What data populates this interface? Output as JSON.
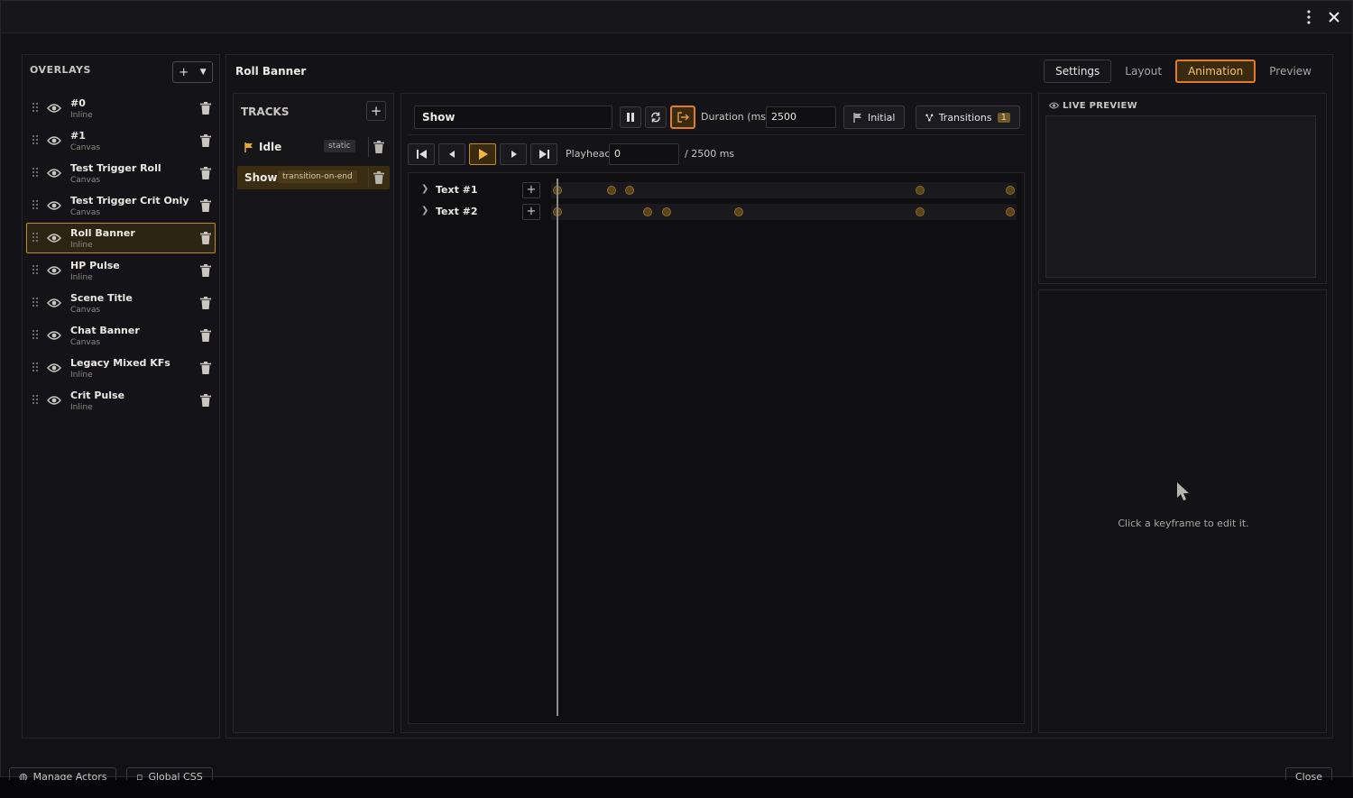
{
  "overlays": {
    "title": "OVERLAYS",
    "items": [
      {
        "name": "#0",
        "type": "Inline"
      },
      {
        "name": "#1",
        "type": "Canvas"
      },
      {
        "name": "Test Trigger Roll",
        "type": "Canvas"
      },
      {
        "name": "Test Trigger Crit Only",
        "type": "Canvas"
      },
      {
        "name": "Roll Banner",
        "type": "Inline",
        "active": true
      },
      {
        "name": "HP Pulse",
        "type": "Inline"
      },
      {
        "name": "Scene Title",
        "type": "Canvas"
      },
      {
        "name": "Chat Banner",
        "type": "Canvas"
      },
      {
        "name": "Legacy Mixed KFs",
        "type": "Inline"
      },
      {
        "name": "Crit Pulse",
        "type": "Inline"
      }
    ]
  },
  "main": {
    "title": "Roll Banner",
    "tabs": [
      {
        "label": "Settings"
      },
      {
        "label": "Layout"
      },
      {
        "label": "Animation",
        "active": true
      },
      {
        "label": "Preview"
      }
    ]
  },
  "tracks": {
    "title": "TRACKS",
    "items": [
      {
        "name": "Idle",
        "badge": "static",
        "icon": "flag-icon"
      },
      {
        "name": "Show",
        "badge": "transition-on-end",
        "active": true
      }
    ]
  },
  "editor": {
    "track_name": "Show",
    "duration_label": "Duration (ms)",
    "duration_value": "2500",
    "initial_label": "Initial",
    "transitions_label": "Transitions",
    "transitions_count": "1",
    "playhead_label": "Playhead",
    "playhead_value": "0",
    "playhead_total": "/ 2500 ms",
    "rows": [
      {
        "name": "Text #1",
        "keyframes_ms": [
          0,
          300,
          400,
          2000,
          2500
        ]
      },
      {
        "name": "Text #2",
        "keyframes_ms": [
          0,
          500,
          600,
          1000,
          2000,
          2500
        ]
      }
    ],
    "duration_ms": 2500
  },
  "preview": {
    "title": "LIVE PREVIEW",
    "hint": "Click a keyframe to edit it."
  },
  "footer": {
    "manage_actors": "Manage Actors",
    "global_css": "Global CSS",
    "close": "Close"
  },
  "colors": {
    "accent": "#e07b2c",
    "active_bg": "#3a2a10",
    "keyframe": "#5a4418"
  }
}
